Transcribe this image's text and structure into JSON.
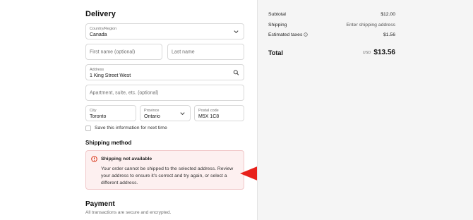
{
  "delivery": {
    "heading": "Delivery",
    "country": {
      "label": "Country/Region",
      "value": "Canada"
    },
    "first_name": {
      "placeholder": "First name (optional)"
    },
    "last_name": {
      "placeholder": "Last name"
    },
    "address": {
      "label": "Address",
      "value": "1 King Street West"
    },
    "apartment": {
      "placeholder": "Apartment, suite, etc. (optional)"
    },
    "city": {
      "label": "City",
      "value": "Toronto"
    },
    "province": {
      "label": "Province",
      "value": "Ontario"
    },
    "postal": {
      "label": "Postal code",
      "value": "M5X 1C8"
    },
    "save_info": "Save this information for next time"
  },
  "shipping_method": {
    "heading": "Shipping method",
    "alert": {
      "title": "Shipping not available",
      "body": "Your order cannot be shipped to the selected address. Review your address to ensure it's correct and try again, or select a different address.",
      "icon": "alert-circle-icon",
      "color": "#d72c0d"
    }
  },
  "payment": {
    "heading": "Payment",
    "subtitle": "All transactions are secure and encrypted."
  },
  "summary": {
    "subtotal_label": "Subtotal",
    "subtotal_value": "$12.00",
    "shipping_label": "Shipping",
    "shipping_value": "Enter shipping address",
    "taxes_label": "Estimated taxes",
    "taxes_value": "$1.56",
    "total_label": "Total",
    "total_currency": "USD",
    "total_value": "$13.56"
  },
  "annotation": {
    "arrow_color": "#e8211b"
  }
}
